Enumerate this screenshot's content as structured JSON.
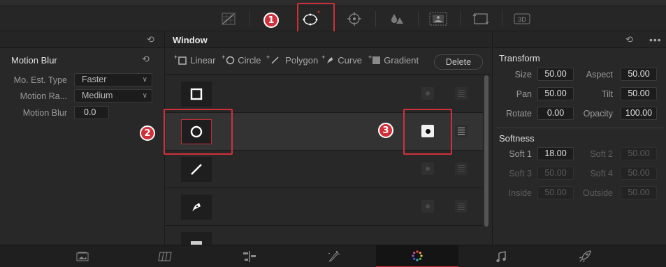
{
  "colors": {
    "accent": "#d0303a",
    "panel": "#282828",
    "selected_row": "#333333"
  },
  "toolbar": {
    "tools": [
      {
        "name": "curves-icon"
      },
      {
        "name": "window-icon",
        "active": true
      },
      {
        "name": "tracker-icon"
      },
      {
        "name": "blur-icon"
      },
      {
        "name": "key-icon"
      },
      {
        "name": "sizing-icon"
      },
      {
        "name": "3d-icon",
        "text": "3D"
      }
    ]
  },
  "callouts": [
    "1",
    "2",
    "3"
  ],
  "left": {
    "title": "Motion Blur",
    "rows": [
      {
        "label": "Mo. Est. Type",
        "value": "Faster",
        "kind": "dropdown"
      },
      {
        "label": "Motion Ra...",
        "value": "Medium",
        "kind": "dropdown"
      },
      {
        "label": "Motion Blur",
        "value": "0.0",
        "kind": "number"
      }
    ]
  },
  "window": {
    "title": "Window",
    "shapes": [
      {
        "label": "Linear",
        "icon": "square-outline-icon"
      },
      {
        "label": "Circle",
        "icon": "circle-outline-icon"
      },
      {
        "label": "Polygon",
        "icon": "polygon-line-icon"
      },
      {
        "label": "Curve",
        "icon": "pen-curve-icon"
      },
      {
        "label": "Gradient",
        "icon": "gradient-icon"
      }
    ],
    "delete_label": "Delete",
    "rows": [
      {
        "shape": "linear",
        "selected": false
      },
      {
        "shape": "circle",
        "selected": true
      },
      {
        "shape": "polygon",
        "selected": false
      },
      {
        "shape": "curve",
        "selected": false
      },
      {
        "shape": "gradient",
        "selected": false
      }
    ]
  },
  "right": {
    "transform": {
      "title": "Transform",
      "fields": [
        {
          "label": "Size",
          "value": "50.00"
        },
        {
          "label": "Aspect",
          "value": "50.00"
        },
        {
          "label": "Pan",
          "value": "50.00"
        },
        {
          "label": "Tilt",
          "value": "50.00"
        },
        {
          "label": "Rotate",
          "value": "0.00"
        },
        {
          "label": "Opacity",
          "value": "100.00"
        }
      ]
    },
    "softness": {
      "title": "Softness",
      "fields": [
        {
          "label": "Soft 1",
          "value": "18.00",
          "enabled": true
        },
        {
          "label": "Soft 2",
          "value": "50.00",
          "enabled": false
        },
        {
          "label": "Soft 3",
          "value": "50.00",
          "enabled": false
        },
        {
          "label": "Soft 4",
          "value": "50.00",
          "enabled": false
        },
        {
          "label": "Inside",
          "value": "50.00",
          "enabled": false
        },
        {
          "label": "Outside",
          "value": "50.00",
          "enabled": false
        }
      ]
    }
  },
  "pages": [
    {
      "name": "media-page-icon"
    },
    {
      "name": "cut-page-icon"
    },
    {
      "name": "edit-page-icon"
    },
    {
      "name": "fusion-page-icon"
    },
    {
      "name": "color-page-icon",
      "active": true
    },
    {
      "name": "fairlight-page-icon"
    },
    {
      "name": "deliver-page-icon"
    }
  ]
}
